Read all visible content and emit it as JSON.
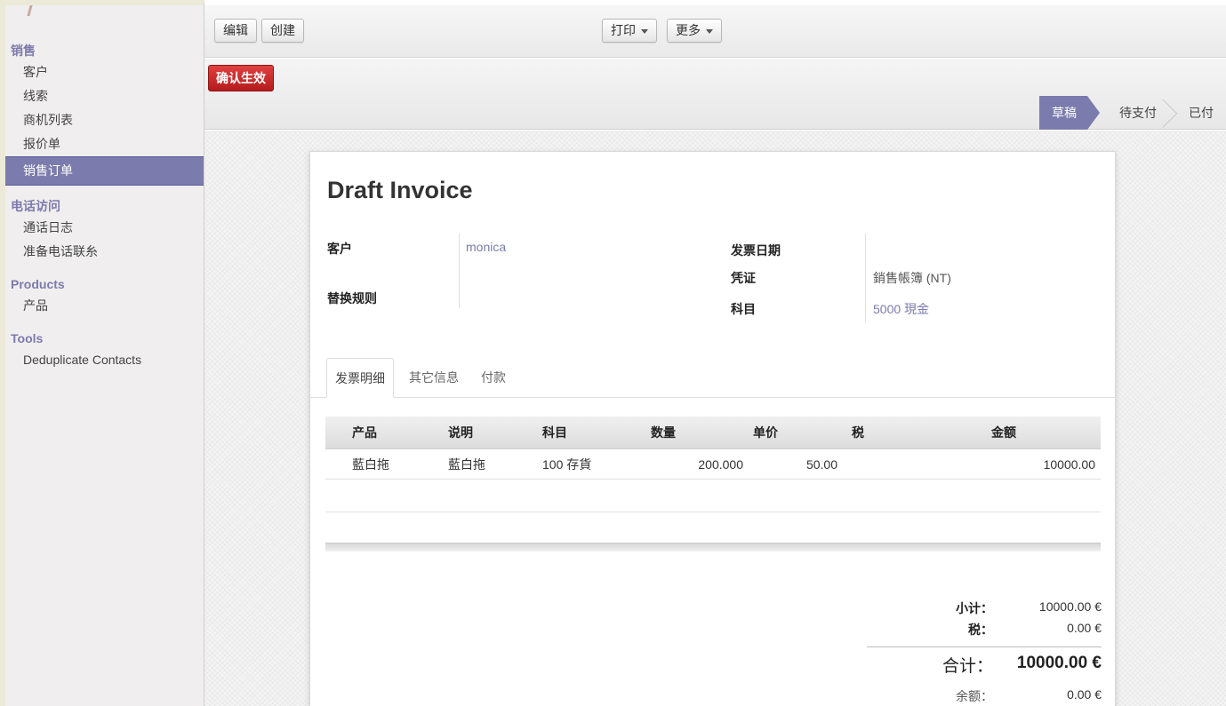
{
  "sidebar": {
    "sections": [
      {
        "title": "销售",
        "items": [
          "客户",
          "线索",
          "商机列表",
          "报价单",
          "销售订单"
        ]
      },
      {
        "title": "电话访问",
        "items": [
          "通话日志",
          "准备电话联糸"
        ]
      },
      {
        "title": "Products",
        "items": [
          "产品"
        ]
      },
      {
        "title": "Tools",
        "items": [
          "Deduplicate Contacts"
        ]
      }
    ],
    "active_item": "销售订单"
  },
  "toolbar": {
    "edit_label": "编辑",
    "create_label": "创建",
    "print_label": "打印",
    "more_label": "更多"
  },
  "action_bar": {
    "confirm_label": "确认生效"
  },
  "status_bar": {
    "stages": [
      "草稿",
      "待支付",
      "已付"
    ],
    "active": "草稿"
  },
  "invoice": {
    "title": "Draft Invoice",
    "left_fields": [
      {
        "label": "客户",
        "value": "monica"
      },
      {
        "label": "替换规则",
        "value": ""
      }
    ],
    "right_fields": [
      {
        "label": "发票日期",
        "value": ""
      },
      {
        "label": "凭证",
        "value": "銷售帳簿 (NT)"
      },
      {
        "label": "科目",
        "value": "5000 現金"
      }
    ],
    "tabs": [
      "发票明细",
      "其它信息",
      "付款"
    ],
    "active_tab": "发票明细",
    "lines": {
      "columns": [
        "产品",
        "说明",
        "科目",
        "数量",
        "单价",
        "税",
        "金额"
      ],
      "rows": [
        [
          "藍白拖",
          "藍白拖",
          "100 存貨",
          "200.000",
          "50.00",
          "",
          "10000.00"
        ]
      ]
    },
    "totals": {
      "subtotal_label": "小计：",
      "subtotal_value": "10000.00 €",
      "tax_label": "税：",
      "tax_value": "0.00 €",
      "total_label": "合计：",
      "total_value": "10000.00 €",
      "residual_label": "余额：",
      "residual_value": "0.00 €"
    }
  },
  "colors": {
    "accent": "#7c7bad",
    "confirm": "#c62828"
  }
}
